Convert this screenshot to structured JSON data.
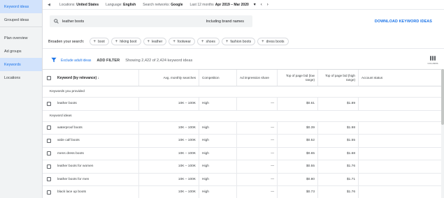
{
  "sidebar": {
    "items": [
      {
        "label": "Keyword ideas",
        "active": true
      },
      {
        "label": "Grouped ideas",
        "active": false
      },
      {
        "label": "Plan overview",
        "active": false
      },
      {
        "label": "Ad groups",
        "active": false
      },
      {
        "label": "Keywords",
        "active": true
      },
      {
        "label": "Locations",
        "active": false
      }
    ]
  },
  "topbar": {
    "locations_label": "Locations:",
    "locations_value": "United States",
    "language_label": "Language:",
    "language_value": "English",
    "networks_label": "Search networks:",
    "networks_value": "Google",
    "period_label": "Last 12 months",
    "period_value": "Apr 2019 – Mar 2020"
  },
  "search": {
    "query": "leather boots",
    "brand_label": "Including brand names",
    "download_label": "DOWNLOAD KEYWORD IDEAS"
  },
  "broaden": {
    "label": "Broaden your search:",
    "chips": [
      "boot",
      "hiking boot",
      "leather",
      "footwear",
      "shoes",
      "fashion boots",
      "dress boots"
    ]
  },
  "toolbar": {
    "exclude_label": "Exclude adult ideas",
    "add_filter_label": "ADD FILTER",
    "count_text": "Showing 2,422 of 2,424 keyword ideas",
    "columns_label": "COLUMNS"
  },
  "table": {
    "headers": {
      "keyword": "Keyword (by relevance) ↓",
      "avg": "Avg. monthly searches",
      "competition": "Competition",
      "impression": "Ad impression share",
      "low_bid": "Top of page bid (low range)",
      "high_bid": "Top of page bid (high range)",
      "status": "Account status"
    },
    "provided_group": "Keywords you provided",
    "provided_rows": [
      {
        "keyword": "leather boots",
        "avg": "10K – 100K",
        "competition": "High",
        "impression": "—",
        "low": "$0.61",
        "high": "$1.89"
      }
    ],
    "ideas_group": "Keyword ideas",
    "idea_rows": [
      {
        "keyword": "waterproof boots",
        "avg": "10K – 100K",
        "competition": "High",
        "impression": "—",
        "low": "$0.39",
        "high": "$1.98"
      },
      {
        "keyword": "wide calf boots",
        "avg": "10K – 100K",
        "competition": "High",
        "impression": "—",
        "low": "$0.52",
        "high": "$1.55"
      },
      {
        "keyword": "mens dress boots",
        "avg": "10K – 100K",
        "competition": "High",
        "impression": "—",
        "low": "$0.65",
        "high": "$1.68"
      },
      {
        "keyword": "leather boots for women",
        "avg": "10K – 100K",
        "competition": "High",
        "impression": "—",
        "low": "$0.55",
        "high": "$1.76"
      },
      {
        "keyword": "leather boots for men",
        "avg": "10K – 100K",
        "competition": "High",
        "impression": "—",
        "low": "$0.80",
        "high": "$1.71"
      },
      {
        "keyword": "black lace up boots",
        "avg": "10K – 100K",
        "competition": "High",
        "impression": "—",
        "low": "$0.73",
        "high": "$1.76"
      }
    ]
  },
  "colors": {
    "accent": "#1a73e8",
    "sidebar_bg": "#f1f3f4",
    "active_bg": "#d2e3fc"
  }
}
